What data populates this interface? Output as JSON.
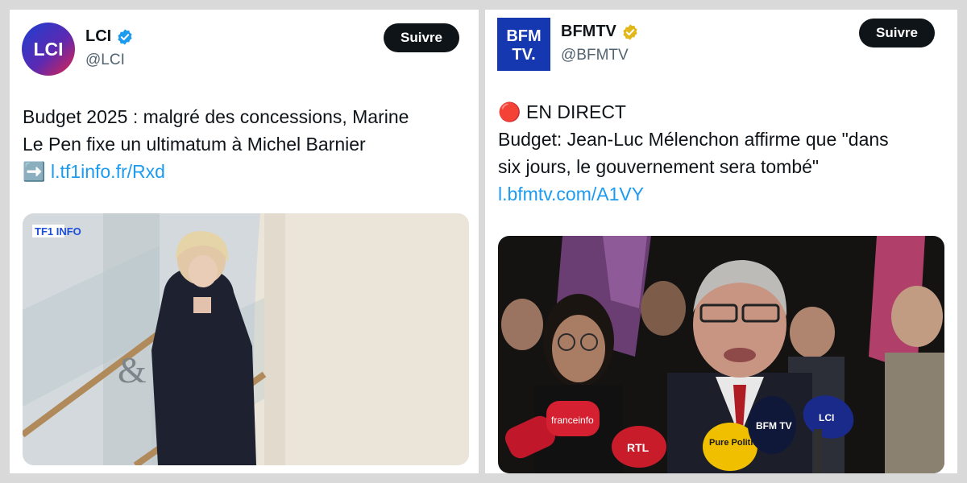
{
  "tweets": [
    {
      "name": "LCI",
      "handle": "@LCI",
      "follow_label": "Suivre",
      "verified": "blue",
      "avatar_text": "LCI",
      "text_line1": "Budget 2025 : malgré des concessions, Marine",
      "text_line2": "Le Pen fixe un ultimatum à Michel Barnier",
      "link_emoji": "➡️",
      "link": "l.tf1info.fr/Rxd",
      "media_watermark": "TF1 INFO"
    },
    {
      "name": "BFMTV",
      "handle": "@BFMTV",
      "follow_label": "Suivre",
      "verified": "gold",
      "avatar_line1": "BFM",
      "avatar_line2": "TV.",
      "live_marker": "🔴",
      "live_label": "EN DIRECT",
      "text_line1": "Budget: Jean-Luc Mélenchon affirme que \"dans",
      "text_line2": "six jours, le gouvernement sera tombé\"",
      "link": "l.bfmtv.com/A1VY",
      "mic_labels": [
        "franceinfo",
        "RTL",
        "Pure Politique",
        "BFM TV",
        "LCI"
      ]
    }
  ],
  "colors": {
    "link": "#1d9bf0",
    "verified_blue": "#1d9bf0",
    "verified_gold": "#e2b719",
    "follow_bg": "#0f1419"
  }
}
